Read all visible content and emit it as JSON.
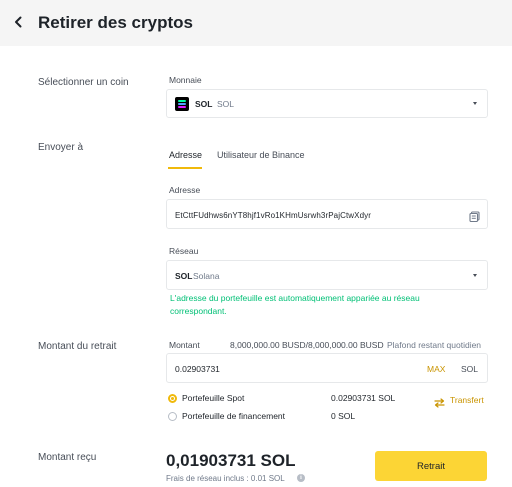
{
  "header": {
    "title": "Retirer des cryptos"
  },
  "coin_section": {
    "label": "Sélectionner un coin",
    "field_label": "Monnaie",
    "coin_symbol": "SOL",
    "coin_name": "SOL"
  },
  "send_section": {
    "label": "Envoyer à",
    "tabs": [
      {
        "label": "Adresse",
        "active": true
      },
      {
        "label": "Utilisateur de Binance",
        "active": false
      }
    ],
    "address_label": "Adresse",
    "address_value": "EtCttFUdhws6nYT8hjf1vRo1KHmUsrwh3rPajCtwXdyr",
    "network_label": "Réseau",
    "network_symbol": "SOL",
    "network_name": "Solana",
    "network_hint": "L'adresse du portefeuille est automatiquement appariée au réseau correspondant."
  },
  "amount_section": {
    "label": "Montant du retrait",
    "field_label": "Montant",
    "limit_text": "8,000,000.00 BUSD/8,000,000.00 BUSD",
    "limit_label": "Plafond restant quotidien",
    "amount_value": "0.02903731",
    "max_label": "MAX",
    "unit": "SOL",
    "wallets": [
      {
        "name": "Portefeuille Spot",
        "balance": "0.02903731 SOL",
        "selected": true
      },
      {
        "name": "Portefeuille de financement",
        "balance": "0 SOL",
        "selected": false
      }
    ],
    "transfer_label": "Transfert"
  },
  "receive_section": {
    "label": "Montant reçu",
    "amount": "0,01903731 SOL",
    "fee_text": "Frais de réseau inclus : 0.01 SOL",
    "submit_label": "Retrait"
  },
  "colors": {
    "accent": "#f0b90b",
    "button": "#fcd535",
    "success": "#02c076",
    "header_bg": "#f5f5f5"
  },
  "icons": [
    "back-arrow-icon",
    "solana-logo-icon",
    "chevron-down-icon",
    "address-book-icon",
    "transfer-icon",
    "info-icon"
  ]
}
